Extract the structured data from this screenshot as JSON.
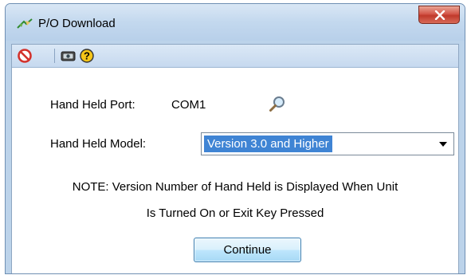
{
  "window": {
    "title": "P/O Download",
    "close_glyph": "X"
  },
  "toolbar": {
    "icons": [
      "stop-icon",
      "device-icon",
      "help-icon"
    ],
    "help_glyph": "?"
  },
  "form": {
    "port_label": "Hand Held Port:",
    "port_value": "COM1",
    "model_label": "Hand Held Model:",
    "model_value": "Version 3.0 and Higher"
  },
  "note": {
    "line1": "NOTE: Version Number of Hand Held is Displayed When Unit",
    "line2": "Is Turned On or Exit Key Pressed"
  },
  "buttons": {
    "continue_label": "Continue"
  },
  "colors": {
    "title_bar": "#c3d8ee",
    "selection": "#3f84d4",
    "close_button": "#c0392b",
    "stop_icon": "#d3322c",
    "help_icon": "#f5c518"
  }
}
